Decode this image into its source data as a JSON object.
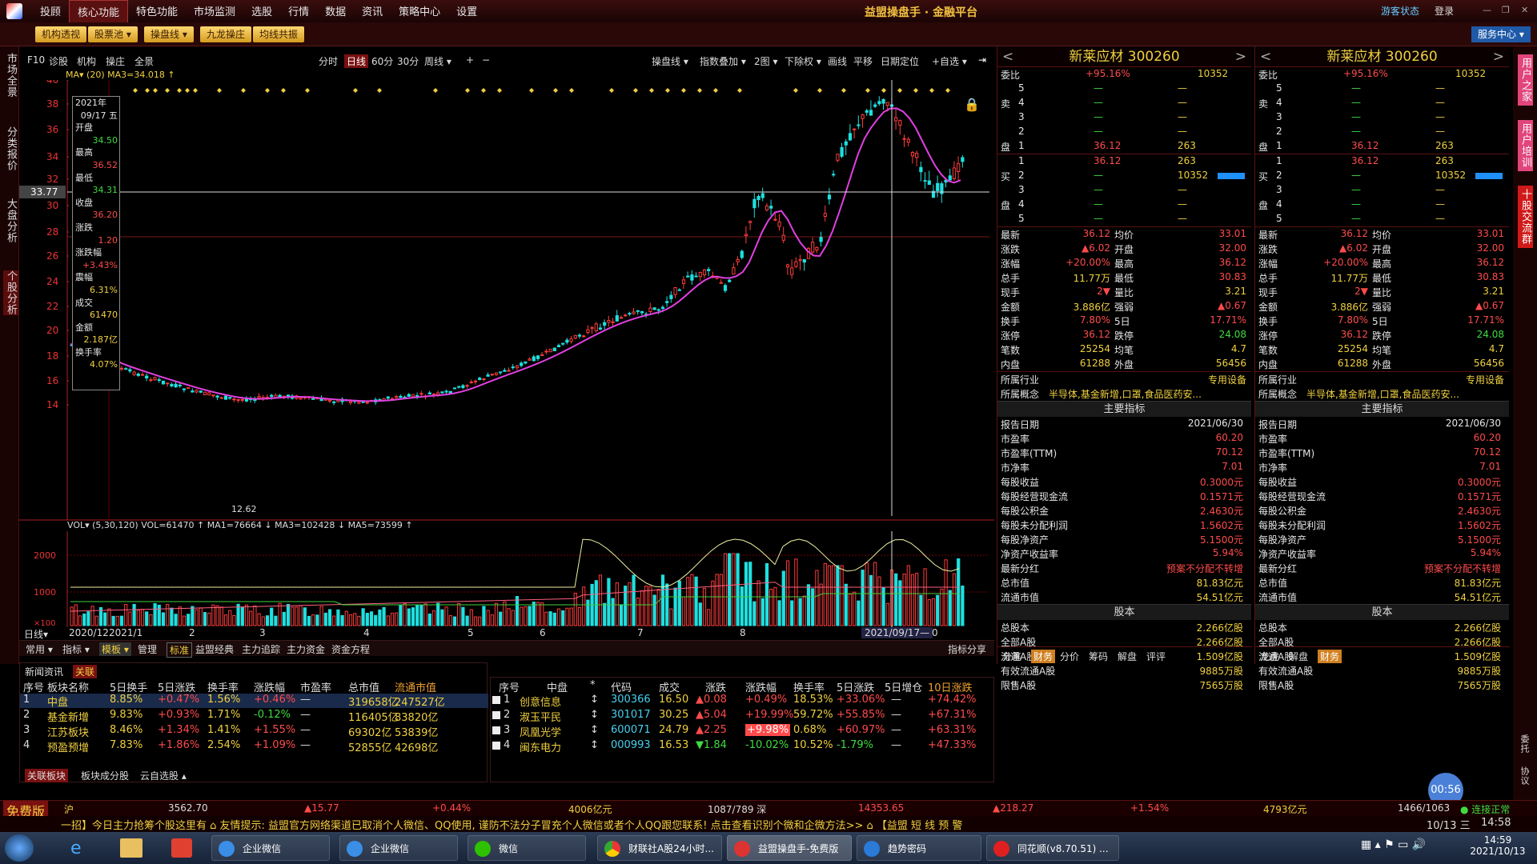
{
  "titlebar": {
    "menu": [
      "投顾",
      "核心功能",
      "特色功能",
      "市场监测",
      "选股",
      "行情",
      "数据",
      "资讯",
      "策略中心",
      "设置"
    ],
    "active_menu": "核心功能",
    "app_title": "益盟操盘手 · 金融平台",
    "guest": "游客状态",
    "login": "登录"
  },
  "toolbar2": {
    "buttons": [
      "机构透视",
      "股票池 ▾",
      "操盘线 ▾",
      "九龙操庄",
      "均线共振"
    ],
    "service": "服务中心 ▾"
  },
  "leftstrip": [
    "市场全景",
    "分类报价",
    "大盘分析",
    "个股分析"
  ],
  "chart_header": {
    "left": [
      "F10",
      "诊股",
      "机构",
      "操庄",
      "全景"
    ],
    "periods": [
      "分时",
      "日线",
      "60分",
      "30分",
      "周线 ▾"
    ],
    "selected_period": "日线",
    "zoom": [
      "+",
      "−"
    ],
    "right": [
      "操盘线 ▾",
      "指数叠加 ▾",
      "2图 ▾",
      "下除权 ▾",
      "画线",
      "平移",
      "日期定位",
      "+自选 ▾"
    ]
  },
  "ma_label": "MA▾ (20) MA3=34.018 ↑",
  "price_axis": [
    "40",
    "38",
    "36",
    "34",
    "32",
    "30",
    "28",
    "26",
    "24",
    "22",
    "20",
    "18",
    "16",
    "14"
  ],
  "crosshair_price": "33.77",
  "low_label": "12.62",
  "infobox": {
    "year": "2021年",
    "date": "09/17 五",
    "open_label": "开盘",
    "open": "34.50",
    "high_label": "最高",
    "high": "36.52",
    "low_label": "最低",
    "low": "34.31",
    "close_label": "收盘",
    "close": "36.20",
    "chg_label": "涨跌",
    "chg": "1.20",
    "pct_label": "涨跌幅",
    "pct": "+3.43%",
    "amp_label": "震幅",
    "amp": "6.31%",
    "vol_label": "成交",
    "vol": "61470",
    "amt_label": "金额",
    "amt": "2.187亿",
    "turn_label": "换手率",
    "turn": "4.07%"
  },
  "vol_label": "VOL▾ (5,30,120) VOL=61470 ↑ MA1=76664 ↓ MA3=102428 ↓ MA5=73599 ↑",
  "vol_axis": [
    "2000",
    "1000",
    "×100"
  ],
  "date_axis": [
    "日线▾",
    "2020/12",
    "2021/1",
    "2",
    "3",
    "4",
    "5",
    "6",
    "7",
    "8",
    "9",
    "2021/09/17—",
    "0"
  ],
  "indicator_tabs": [
    "常用 ▾",
    "指标 ▾",
    "模板 ▾",
    "管理",
    "标准",
    "益盟经典",
    "主力追踪",
    "主力资金",
    "资金方程"
  ],
  "indicator_right": "指标分享",
  "quote_panels": [
    {
      "name": "新莱应材",
      "code": "300260",
      "weibi_label": "委比",
      "weibi": "+95.16%",
      "weicha": "10352",
      "sell": [
        [
          "5",
          "—",
          "—"
        ],
        [
          "4",
          "—",
          "—"
        ],
        [
          "3",
          "—",
          "—"
        ],
        [
          "2",
          "—",
          "—"
        ],
        [
          "1",
          "36.12",
          "263"
        ]
      ],
      "buy": [
        [
          "1",
          "36.12",
          "263"
        ],
        [
          "2",
          "—",
          "10352"
        ],
        [
          "3",
          "—",
          "—"
        ],
        [
          "4",
          "—",
          "—"
        ],
        [
          "5",
          "—",
          "—"
        ]
      ],
      "stats": [
        [
          "最新",
          "36.12",
          "均价",
          "33.01"
        ],
        [
          "涨跌",
          "▲6.02",
          "开盘",
          "32.00"
        ],
        [
          "涨幅",
          "+20.00%",
          "最高",
          "36.12"
        ],
        [
          "总手",
          "11.77万",
          "最低",
          "30.83"
        ],
        [
          "现手",
          "2▼",
          "量比",
          "3.21"
        ],
        [
          "金额",
          "3.886亿",
          "强弱",
          "▲0.67"
        ],
        [
          "换手",
          "7.80%",
          "5日",
          "17.71%"
        ],
        [
          "涨停",
          "36.12",
          "跌停",
          "24.08"
        ],
        [
          "笔数",
          "25254",
          "均笔",
          "4.7"
        ],
        [
          "内盘",
          "61288",
          "外盘",
          "56456"
        ]
      ],
      "industry_label": "所属行业",
      "industry": "专用设备",
      "concept_label": "所属概念",
      "concept": "半导体,基金新增,口罩,食品医药安...",
      "main_title": "主要指标",
      "indicators": [
        [
          "报告日期",
          "2021/06/30"
        ],
        [
          "市盈率",
          "60.20"
        ],
        [
          "市盈率(TTM)",
          "70.12"
        ],
        [
          "市净率",
          "7.01"
        ],
        [
          "每股收益",
          "0.3000元"
        ],
        [
          "每股经营现金流",
          "0.1571元"
        ],
        [
          "每股公积金",
          "2.4630元"
        ],
        [
          "每股未分配利润",
          "1.5602元"
        ],
        [
          "每股净资产",
          "5.1500元"
        ],
        [
          "净资产收益率",
          "5.94%"
        ],
        [
          "最新分红",
          "预案不分配不转增"
        ],
        [
          "总市值",
          "81.83亿元"
        ],
        [
          "流通市值",
          "54.51亿元"
        ]
      ],
      "share_title": "股本",
      "shares": [
        [
          "总股本",
          "2.266亿股"
        ],
        [
          "全部A股",
          "2.266亿股"
        ],
        [
          "流通A股",
          "1.509亿股"
        ],
        [
          "有效流通A股",
          "9885万股"
        ],
        [
          "限售A股",
          "7565万股"
        ]
      ],
      "bottom_tabs": [
        "分笔",
        "财务",
        "分价",
        "筹码",
        "解盘",
        "评评"
      ]
    },
    {
      "name": "新莱应材",
      "code": "300260",
      "bottom_tabs": [
        "龙虎",
        "解盘",
        "财务"
      ]
    }
  ],
  "right_strip": [
    "用户之家",
    "用户培训",
    "十股交流群",
    "委托",
    "协议"
  ],
  "sector_table": {
    "tabs": [
      "新闻资讯",
      "关联"
    ],
    "headers": [
      "序号",
      "板块名称",
      "5日换手",
      "5日涨跌",
      "换手率",
      "涨跌幅",
      "市盈率",
      "总市值",
      "流通市值"
    ],
    "rows": [
      [
        "1",
        "中盘",
        "8.85%",
        "+0.47%",
        "1.56%",
        "+0.46%",
        "—",
        "319658亿",
        "247527亿"
      ],
      [
        "2",
        "基金新增",
        "9.83%",
        "+0.93%",
        "1.71%",
        "-0.12%",
        "—",
        "116405亿",
        "83820亿"
      ],
      [
        "3",
        "江苏板块",
        "8.46%",
        "+1.34%",
        "1.41%",
        "+1.55%",
        "—",
        "69302亿",
        "53839亿"
      ],
      [
        "4",
        "预盈预增",
        "7.83%",
        "+1.86%",
        "2.54%",
        "+1.09%",
        "—",
        "52855亿",
        "42698亿"
      ]
    ],
    "bottom_tabs": [
      "关联板块",
      "板块成分股",
      "云自选股 ▴"
    ]
  },
  "stock_table": {
    "headers": [
      "序号",
      "中盘",
      "*",
      "代码",
      "成交",
      "涨跌",
      "涨跌幅",
      "换手率",
      "5日涨跌",
      "5日增仓",
      "10日涨跌"
    ],
    "rows": [
      [
        "1",
        "创意信息",
        "↕",
        "300366",
        "16.50",
        "▲0.08",
        "+0.49%",
        "18.53%",
        "+33.06%",
        "—",
        "+74.42%"
      ],
      [
        "2",
        "淑玉平民",
        "↕",
        "301017",
        "30.25",
        "▲5.04",
        "+19.99%",
        "59.72%",
        "+55.85%",
        "—",
        "+67.31%"
      ],
      [
        "3",
        "凤凰光学",
        "↕",
        "600071",
        "24.79",
        "▲2.25",
        "+9.98%",
        "0.68%",
        "+60.97%",
        "—",
        "+63.31%"
      ],
      [
        "4",
        "闽东电力",
        "↕",
        "000993",
        "16.53",
        "▼1.84",
        "-10.02%",
        "10.52%",
        "-1.79%",
        "—",
        "+47.33%"
      ]
    ]
  },
  "status1": {
    "edition": "免费版",
    "market": "沪",
    "idx": "3562.70",
    "chg": "▲15.77",
    "pct": "+0.44%",
    "amt": "4006亿元",
    "ratio": "1087/789 深",
    "idx2": "14353.65",
    "chg2": "▲218.27",
    "pct2": "+1.54%",
    "amt2": "4793亿元",
    "ratio2": "1466/1063",
    "conn": "● 连接正常"
  },
  "status2": {
    "ticker": "一招】今日主力抢筹个股这里有    ⌂ 友情提示: 益盟官方网络渠道已取消个人微信、QQ使用, 谨防不法分子冒充个人微信或者个人QQ跟您联系! 点击查看识别个微和企微方法>>    ⌂ 【益盟    短 线 预 警",
    "date": "10/13 三",
    "time": "14:58"
  },
  "timer": "00:56",
  "taskbar": {
    "items": [
      "企业微信",
      "企业微信",
      "微信",
      "财联社A股24小时...",
      "益盟操盘手-免费版",
      "趋势密码",
      "同花顺(v8.70.51) ..."
    ],
    "time": "14:59",
    "date": "2021/10/13"
  }
}
